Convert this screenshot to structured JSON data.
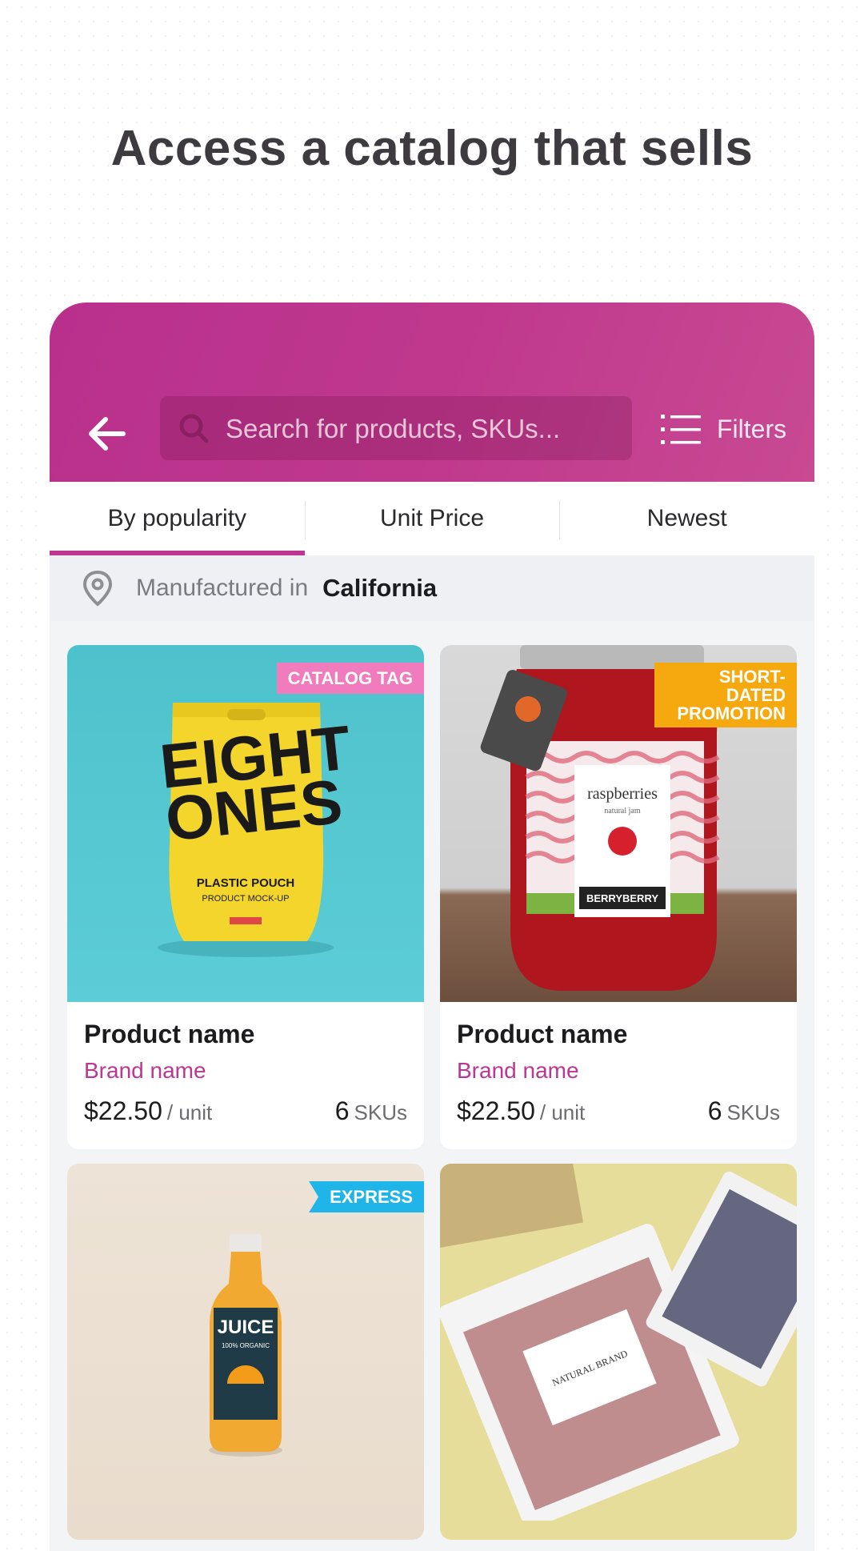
{
  "headline": "Access a catalog that sells",
  "header": {
    "back_icon": "arrow-left-icon",
    "search": {
      "placeholder": "Search for products, SKUs...",
      "value": ""
    },
    "filters_label": "Filters",
    "filters_icon": "list-icon"
  },
  "tabs": [
    {
      "label": "By popularity",
      "active": true
    },
    {
      "label": "Unit Price",
      "active": false
    },
    {
      "label": "Newest",
      "active": false
    }
  ],
  "location": {
    "label": "Manufactured in",
    "value": "California",
    "icon": "location-pin-icon"
  },
  "products": [
    {
      "name": "Product name",
      "brand": "Brand name",
      "price": "$22.50",
      "unit": "/ unit",
      "sku_count": "6",
      "sku_label": "SKUs",
      "badge": "CATALOG TAG",
      "image": {
        "pouch_text": [
          "EIGHT",
          "ONES"
        ],
        "sub1": "PLASTIC POUCH",
        "sub2": "PRODUCT MOCK-UP"
      }
    },
    {
      "name": "Product name",
      "brand": "Brand name",
      "price": "$22.50",
      "unit": "/ unit",
      "sku_count": "6",
      "sku_label": "SKUs",
      "badge_line1": "SHORT-DATED",
      "badge_line2": "PROMOTION",
      "image": {
        "jar_title": "raspberries",
        "jar_sub": "natural jam",
        "jar_brand": "BERRYBERRY"
      }
    },
    {
      "badge": "EXPRESS",
      "image": {
        "bottle_title": "JUICE",
        "bottle_sub": "100% ORGANIC"
      }
    },
    {
      "image": {
        "label_text": "NATURAL BRAND"
      }
    }
  ],
  "colors": {
    "brand": "#bd3690",
    "catalog_tag": "#f07bbd",
    "promo": "#f5a90e",
    "express": "#1fb5e8"
  }
}
